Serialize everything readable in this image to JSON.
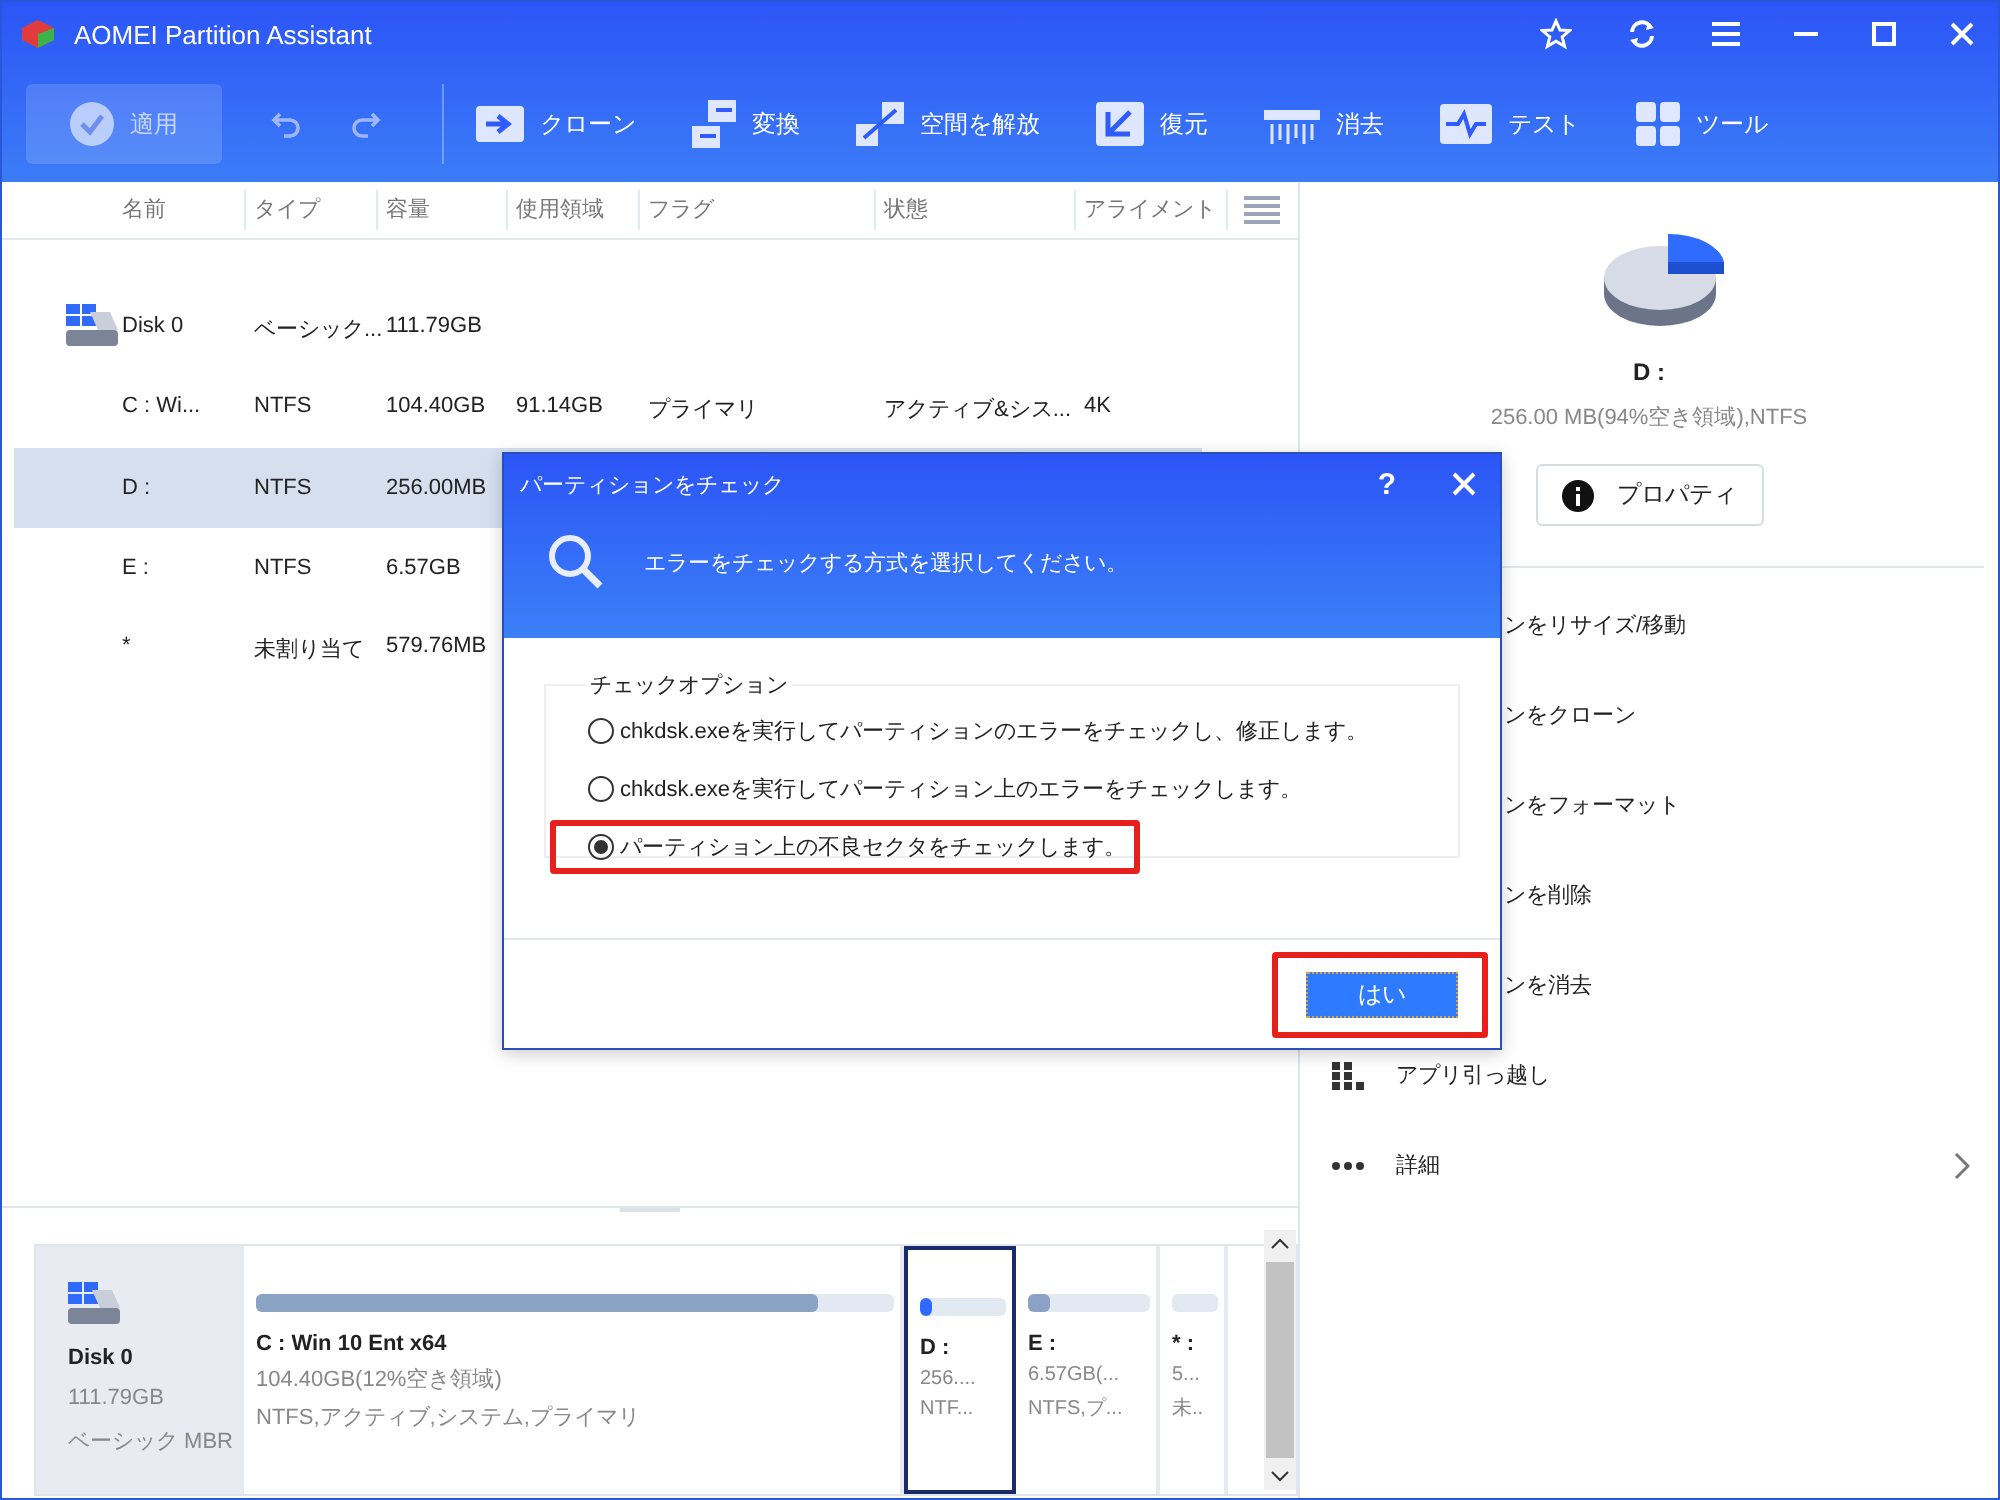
{
  "window": {
    "title": "AOMEI Partition Assistant"
  },
  "toolbar": {
    "apply": {
      "label": "適用",
      "disabled": true
    },
    "tools": [
      {
        "label": "クローン",
        "kind": "clone"
      },
      {
        "label": "変換",
        "kind": "convert"
      },
      {
        "label": "空間を解放",
        "kind": "free"
      },
      {
        "label": "復元",
        "kind": "restore"
      },
      {
        "label": "消去",
        "kind": "wipe"
      },
      {
        "label": "テスト",
        "kind": "test"
      },
      {
        "label": "ツール",
        "kind": "tools"
      }
    ]
  },
  "table": {
    "columns": [
      "名前",
      "タイプ",
      "容量",
      "使用領域",
      "フラグ",
      "状態",
      "アライメント"
    ],
    "rows": [
      {
        "kind": "disk",
        "selected": false,
        "cells": [
          "Disk 0",
          "ベーシック...",
          "111.79GB",
          "",
          "",
          "",
          ""
        ]
      },
      {
        "kind": "partition",
        "selected": false,
        "cells": [
          "C : Wi...",
          "NTFS",
          "104.40GB",
          "91.14GB",
          "プライマリ",
          "アクティブ&シス...",
          "4K"
        ]
      },
      {
        "kind": "partition",
        "selected": true,
        "cells": [
          "D :",
          "NTFS",
          "256.00MB",
          "",
          "",
          "",
          ""
        ]
      },
      {
        "kind": "partition",
        "selected": false,
        "cells": [
          "E :",
          "NTFS",
          "6.57GB",
          "",
          "",
          "",
          ""
        ]
      },
      {
        "kind": "partition",
        "selected": false,
        "cells": [
          "*",
          "未割り当て",
          "579.76MB",
          "",
          "",
          "",
          ""
        ]
      }
    ]
  },
  "side_panel": {
    "drive": "D :",
    "info": "256.00 MB(94%空き領域),NTFS",
    "properties_button": "プロパティ",
    "operations": [
      {
        "label": "ンをリサイズ/移動",
        "kind": "covered"
      },
      {
        "label": "ンをクローン",
        "kind": "covered"
      },
      {
        "label": "ンをフォーマット",
        "kind": "covered"
      },
      {
        "label": "ンを削除",
        "kind": "covered"
      },
      {
        "label": "ンを消去",
        "kind": "covered"
      },
      {
        "label": "アプリ引っ越し",
        "kind": "apps"
      },
      {
        "label": "詳細",
        "kind": "more"
      }
    ]
  },
  "disk_map": {
    "disk": {
      "name": "Disk 0",
      "size": "111.79GB",
      "type": "ベーシック MBR"
    },
    "partitions": [
      {
        "name": "C : Win 10 Ent x64",
        "size": "104.40GB(12%空き領域)",
        "details": "NTFS,アクティブ,システム,プライマリ",
        "level": 0.88,
        "selected": false,
        "color": "#8aa2c4"
      },
      {
        "name": "D :",
        "size": "256....",
        "details": "NTF...",
        "level": 0.15,
        "selected": true,
        "color": "#2f6bff"
      },
      {
        "name": "E :",
        "size": "6.57GB(...",
        "details": "NTFS,プ...",
        "level": 0.18,
        "selected": false,
        "color": "#8aa2c4"
      },
      {
        "name": "* :",
        "size": "5...",
        "details": "未..",
        "selected": false
      }
    ]
  },
  "dialog": {
    "title": "パーティションをチェック",
    "help": "?",
    "message": "エラーをチェックする方式を選択してください。",
    "group_title": "チェックオプション",
    "options": [
      {
        "label": "chkdsk.exeを実行してパーティションのエラーをチェックし、修正します。",
        "selected": false,
        "highlighted": false
      },
      {
        "label": "chkdsk.exeを実行してパーティション上のエラーをチェックします。",
        "selected": false,
        "highlighted": false
      },
      {
        "label": "パーティション上の不良セクタをチェックします。",
        "selected": true,
        "highlighted": true
      }
    ],
    "ok_button": {
      "label": "はい",
      "highlighted": true
    }
  }
}
